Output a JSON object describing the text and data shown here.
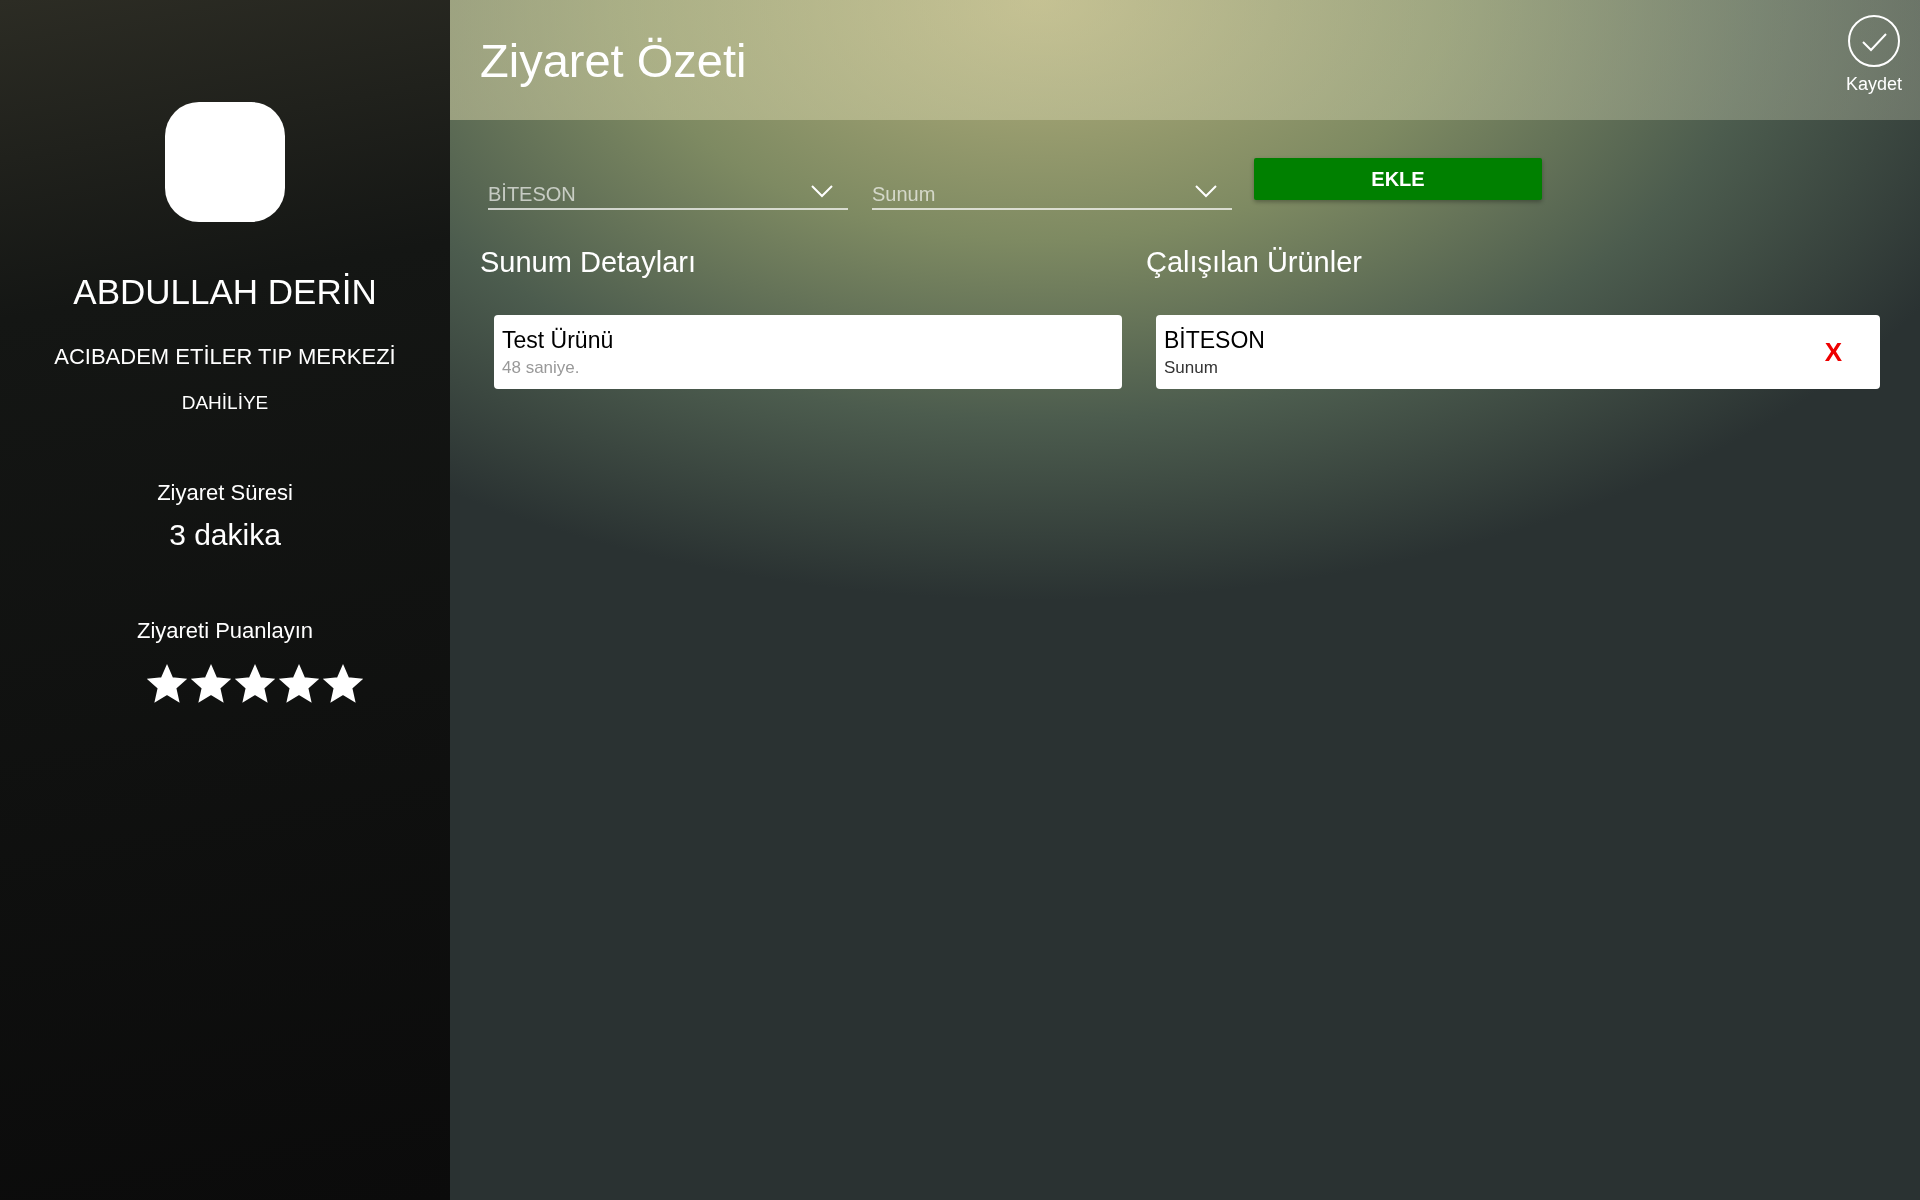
{
  "sidebar": {
    "name": "ABDULLAH DERİN",
    "institution": "ACIBADEM ETİLER TIP MERKEZİ",
    "department": "DAHİLİYE",
    "duration_label": "Ziyaret Süresi",
    "duration": "3 dakika",
    "rating_label": "Ziyareti Puanlayın",
    "rating": {
      "stars": 5
    }
  },
  "header": {
    "title": "Ziyaret Özeti",
    "save_label": "Kaydet"
  },
  "form": {
    "product": {
      "value": "BİTESON"
    },
    "activity": {
      "value": "Sunum"
    },
    "add_button": "EKLE"
  },
  "presentation_details": {
    "title": "Sunum Detayları",
    "items": [
      {
        "name": "Test Ürünü",
        "detail": "48 saniye."
      }
    ]
  },
  "worked_products": {
    "title": "Çalışılan Ürünler",
    "items": [
      {
        "name": "BİTESON",
        "detail": "Sunum",
        "remove": "X"
      }
    ]
  }
}
